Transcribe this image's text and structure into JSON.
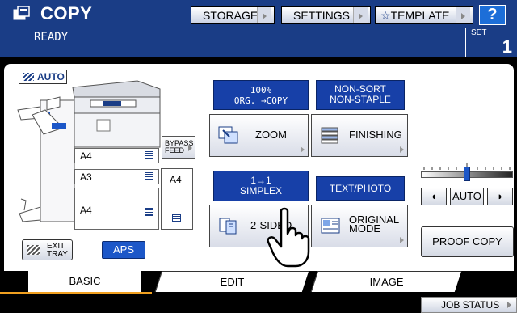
{
  "header": {
    "title": "COPY",
    "status": "READY",
    "buttons": {
      "storage": "STORAGE",
      "settings": "SETTINGS",
      "template": "TEMPLATE",
      "help": "?"
    },
    "set_label": "SET",
    "set_value": "1"
  },
  "original": {
    "auto_label": "AUTO"
  },
  "trays": [
    {
      "label": "A4"
    },
    {
      "label": "A3"
    },
    {
      "label": "A4"
    }
  ],
  "bypass": {
    "label_line1": "BYPASS",
    "label_line2": "FEED",
    "paper": "A4"
  },
  "exit_tray": {
    "line1": "EXIT",
    "line2": "TRAY"
  },
  "aps_label": "APS",
  "zoom": {
    "info_line1": "100%",
    "info_line2": "ORG. →COPY",
    "button": "ZOOM"
  },
  "finishing": {
    "info_line1": "NON-SORT",
    "info_line2": "NON-STAPLE",
    "button": "FINISHING"
  },
  "sided": {
    "info_line1": "1→1",
    "info_line2": "SIMPLEX",
    "button": "2-SIDED"
  },
  "original_mode": {
    "info": "TEXT/PHOTO",
    "button_line1": "ORIGINAL",
    "button_line2": "MODE"
  },
  "density": {
    "auto_label": "AUTO",
    "level": 0.5
  },
  "proof_copy": "PROOF COPY",
  "tabs": {
    "basic": "BASIC",
    "edit": "EDIT",
    "image": "IMAGE"
  },
  "job_status": "JOB STATUS",
  "colors": {
    "header_bg": "#1a3d86",
    "accent_blue": "#1740a8",
    "help_blue": "#1c6ed8",
    "tab_underline": "#f0a020"
  }
}
